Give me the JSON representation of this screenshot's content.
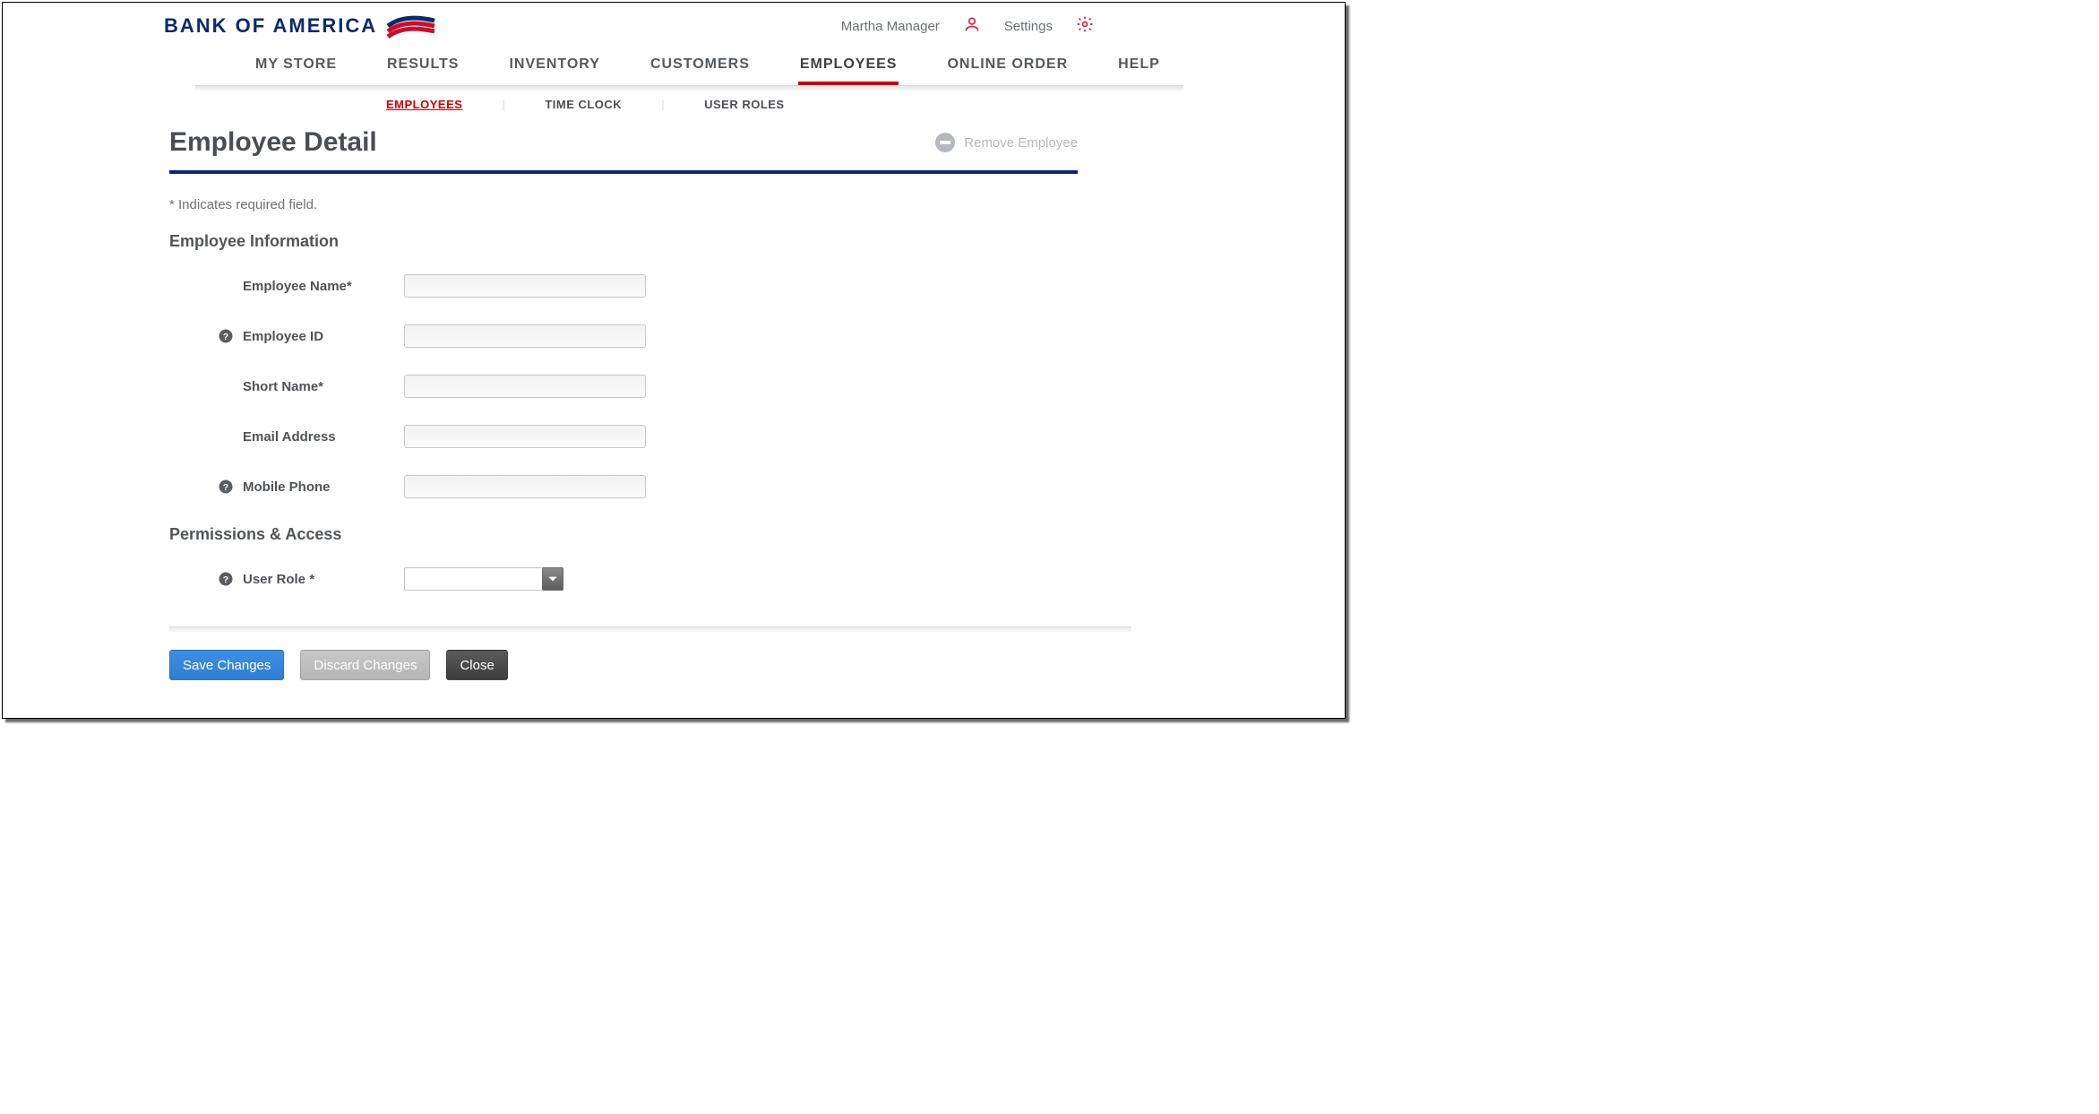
{
  "header": {
    "brand_text": "BANK OF AMERICA",
    "user_name": "Martha Manager",
    "settings_label": "Settings"
  },
  "nav": {
    "tabs": [
      {
        "label": "MY STORE"
      },
      {
        "label": "RESULTS"
      },
      {
        "label": "INVENTORY"
      },
      {
        "label": "CUSTOMERS"
      },
      {
        "label": "EMPLOYEES",
        "active": true
      },
      {
        "label": "ONLINE ORDER"
      },
      {
        "label": "HELP"
      }
    ],
    "subtabs": [
      {
        "label": "EMPLOYEES",
        "active": true
      },
      {
        "label": "TIME CLOCK"
      },
      {
        "label": "USER ROLES"
      }
    ]
  },
  "page": {
    "title": "Employee Detail",
    "remove_label": "Remove Employee",
    "required_note": "* Indicates required field.",
    "sections": {
      "info_title": "Employee Information",
      "perm_title": "Permissions & Access"
    },
    "fields": {
      "employee_name": {
        "label": "Employee Name*",
        "value": ""
      },
      "employee_id": {
        "label": "Employee ID",
        "value": "",
        "has_help": true
      },
      "short_name": {
        "label": "Short Name*",
        "value": ""
      },
      "email": {
        "label": "Email Address",
        "value": ""
      },
      "mobile": {
        "label": "Mobile Phone",
        "value": "",
        "has_help": true
      },
      "user_role": {
        "label": "User Role *",
        "value": "",
        "has_help": true
      }
    }
  },
  "buttons": {
    "save": "Save Changes",
    "discard": "Discard Changes",
    "close": "Close"
  }
}
